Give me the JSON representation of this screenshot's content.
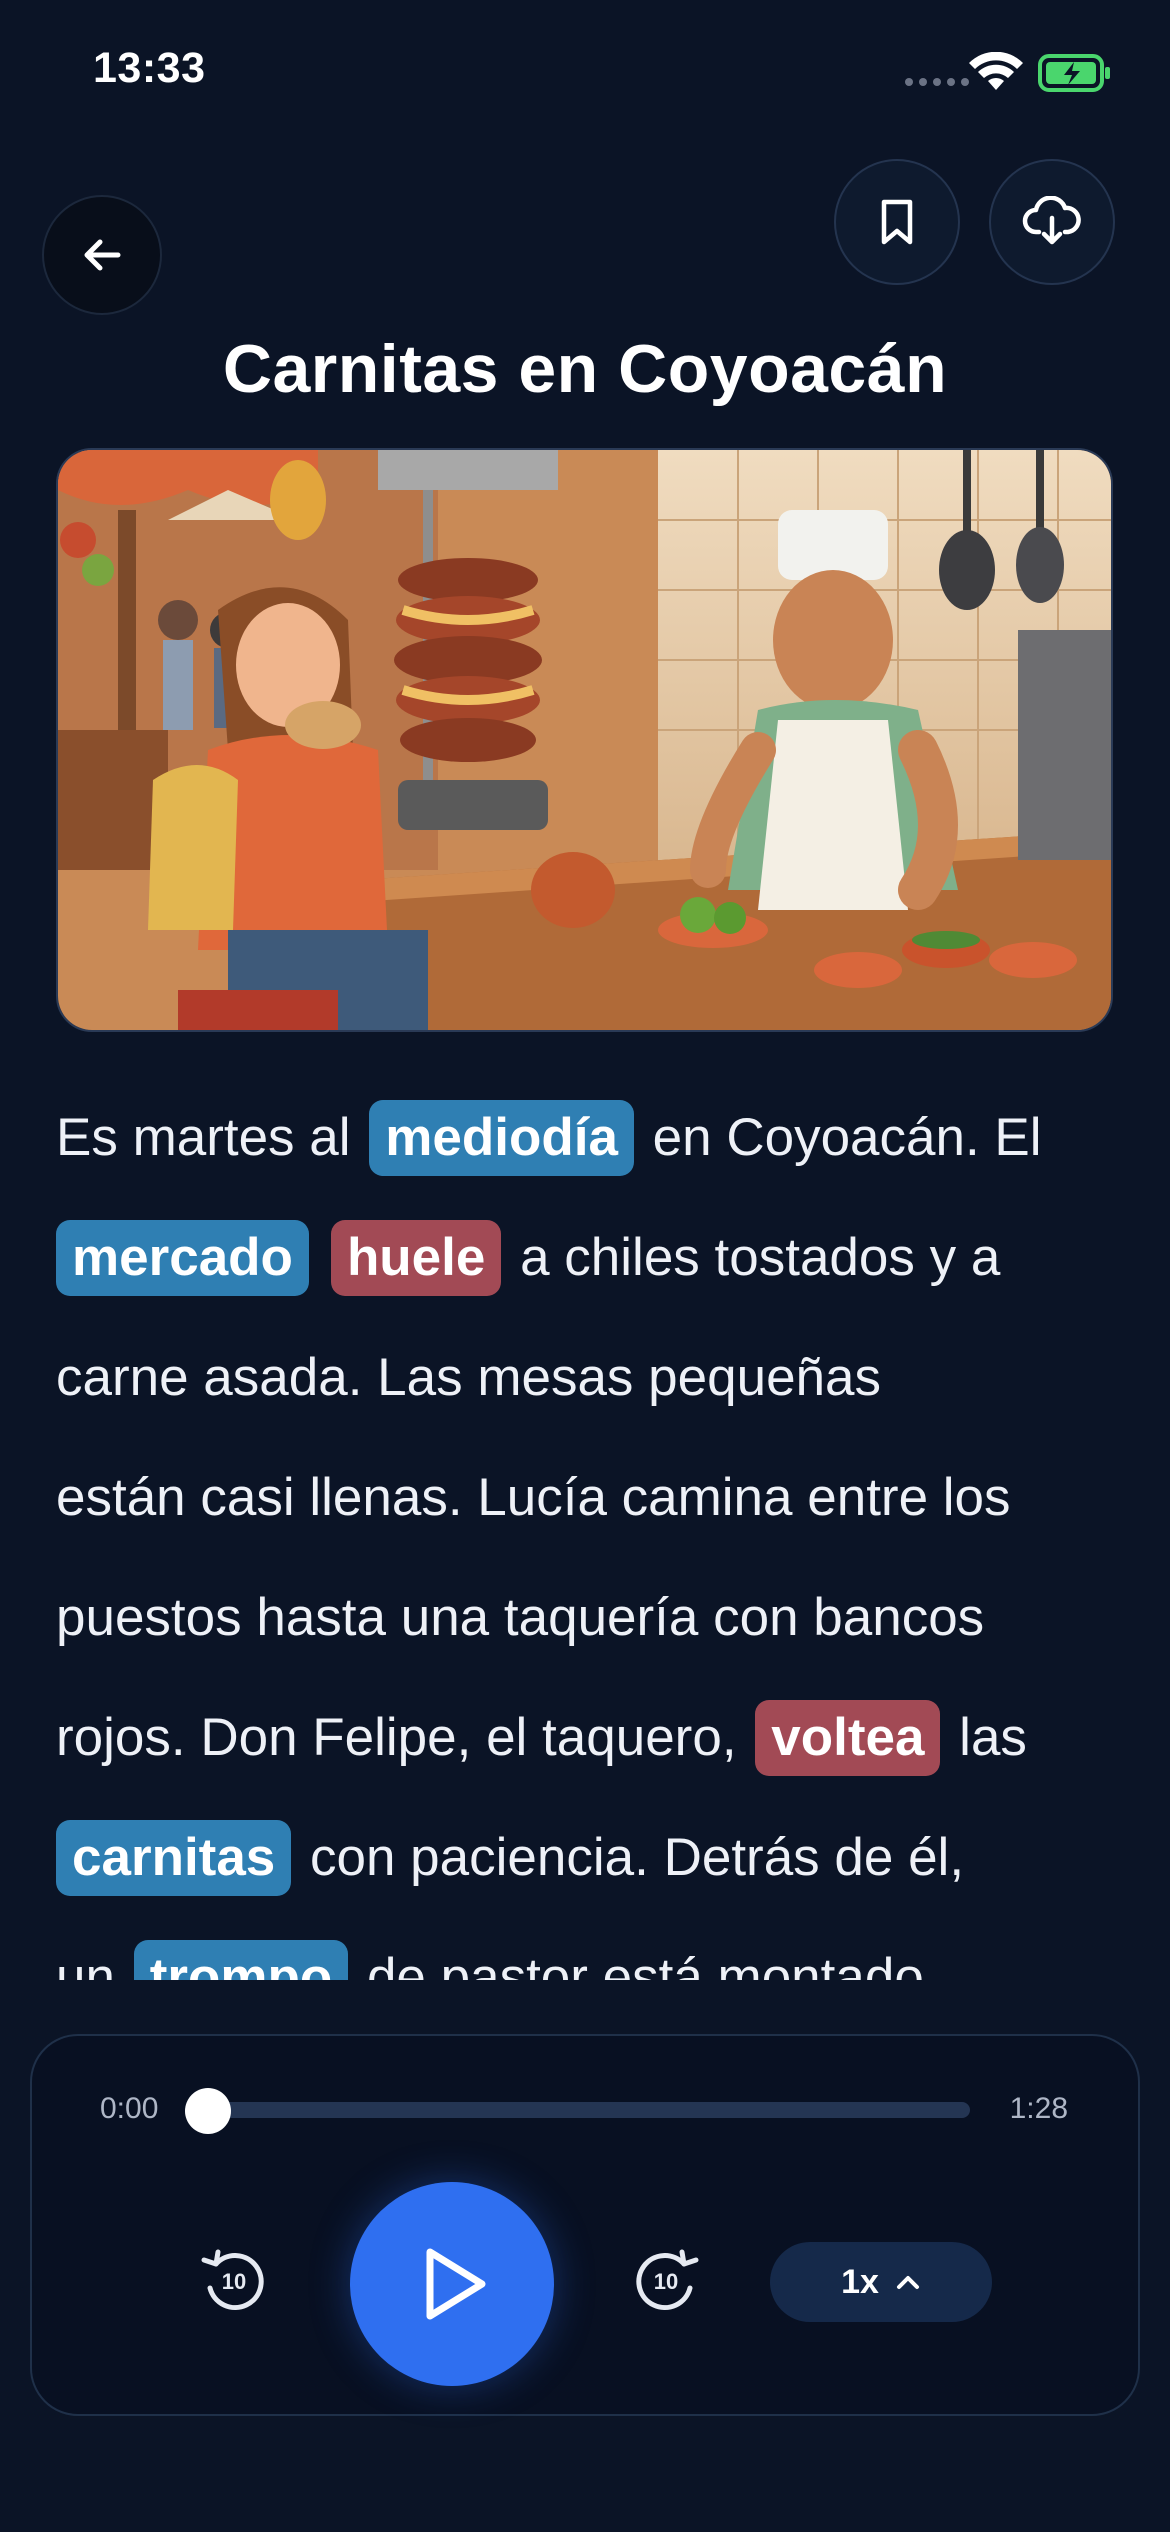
{
  "status_bar": {
    "time": "13:33"
  },
  "header": {
    "title": "Carnitas en Coyoacán"
  },
  "icons": {
    "back": "arrow-left-icon",
    "bookmark": "bookmark-icon",
    "download": "cloud-download-icon",
    "rewind": "rewind-10-icon",
    "forward": "forward-10-icon",
    "play": "play-icon",
    "speed_chevron": "chevron-up-icon"
  },
  "story": {
    "lines": [
      [
        {
          "t": "Es martes al "
        },
        {
          "t": "mediodía",
          "hl": "blue"
        },
        {
          "t": " en Coyoacán. El"
        }
      ],
      [
        {
          "t": "mercado",
          "hl": "blue"
        },
        {
          "t": "huele",
          "hl": "red"
        },
        {
          "t": " a chiles tostados y a"
        }
      ],
      [
        {
          "t": "carne asada. Las mesas pequeñas"
        }
      ],
      [
        {
          "t": "están casi llenas. Lucía camina entre los"
        }
      ],
      [
        {
          "t": "puestos hasta una taquería con bancos"
        }
      ],
      [
        {
          "t": "rojos. Don Felipe, el taquero, "
        },
        {
          "t": "voltea",
          "hl": "red"
        },
        {
          "t": " las"
        }
      ],
      [
        {
          "t": "carnitas",
          "hl": "blue"
        },
        {
          "t": " con paciencia. Detrás de él,"
        }
      ],
      [
        {
          "t": "un "
        },
        {
          "t": "trompo",
          "hl": "blue"
        },
        {
          "t": " de pastor está montado"
        }
      ]
    ],
    "highlight_colors": {
      "blue": "#2f7fb3",
      "red": "#a24a55"
    }
  },
  "player": {
    "current_time": "0:00",
    "total_time": "1:28",
    "progress": 0,
    "rewind_seconds": "10",
    "forward_seconds": "10",
    "speed": "1x",
    "accent_color": "#2f6ff0"
  }
}
